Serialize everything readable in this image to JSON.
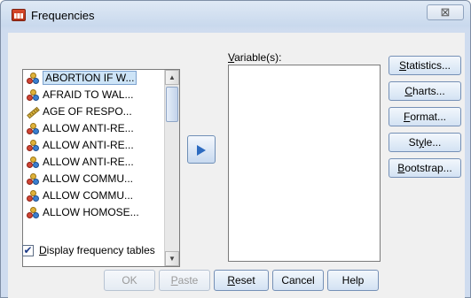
{
  "window": {
    "title": "Frequencies",
    "close_glyph": "⊠"
  },
  "source_list": {
    "items": [
      {
        "label": "ABORTION IF W...",
        "icon": "nominal-variable-icon",
        "selected": true
      },
      {
        "label": "AFRAID TO WAL...",
        "icon": "nominal-variable-icon",
        "selected": false
      },
      {
        "label": "AGE OF RESPO...",
        "icon": "scale-variable-icon",
        "selected": false
      },
      {
        "label": "ALLOW ANTI-RE...",
        "icon": "nominal-variable-icon",
        "selected": false
      },
      {
        "label": "ALLOW ANTI-RE...",
        "icon": "nominal-variable-icon",
        "selected": false
      },
      {
        "label": "ALLOW ANTI-RE...",
        "icon": "nominal-variable-icon",
        "selected": false
      },
      {
        "label": "ALLOW COMMU...",
        "icon": "nominal-variable-icon",
        "selected": false
      },
      {
        "label": "ALLOW COMMU...",
        "icon": "nominal-variable-icon",
        "selected": false
      },
      {
        "label": "ALLOW HOMOSE...",
        "icon": "nominal-variable-icon",
        "selected": false
      }
    ]
  },
  "target": {
    "label": "Variable(s):"
  },
  "side_buttons": [
    {
      "name": "statistics-button",
      "label": "Statistics..."
    },
    {
      "name": "charts-button",
      "label": "Charts..."
    },
    {
      "name": "format-button",
      "label": "Format..."
    },
    {
      "name": "style-button",
      "label": "Style..."
    },
    {
      "name": "bootstrap-button",
      "label": "Bootstrap..."
    }
  ],
  "options": {
    "display_frequency_tables": "Display frequency tables",
    "checked": true
  },
  "bottom_buttons": {
    "ok": "OK",
    "paste": "Paste",
    "reset": "Reset",
    "cancel": "Cancel",
    "help": "Help"
  },
  "colors": {
    "accent": "#2d6bc0",
    "selection": "#cde4f7"
  }
}
